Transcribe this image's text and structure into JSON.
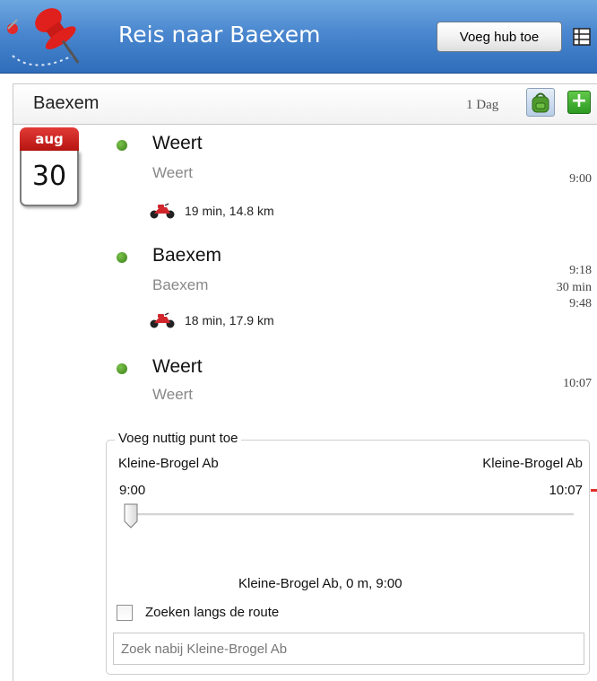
{
  "header": {
    "title": "Reis naar Baexem",
    "add_hub_label": "Voeg hub toe",
    "app_icon": "pushpin-route-icon",
    "grid_icon": "grid-list-icon"
  },
  "subheader": {
    "destination": "Baexem",
    "days": "1 Dag",
    "bag_icon": "backpack-icon",
    "add_icon": "plus-icon",
    "add_symbol": "+"
  },
  "calendar": {
    "month": "aug",
    "day": "30"
  },
  "stops": [
    {
      "name": "Weert",
      "sub": "Weert",
      "time_lines": [
        "9:00"
      ]
    },
    {
      "name": "Baexem",
      "sub": "Baexem",
      "time_lines": [
        "9:18",
        "30 min",
        "9:48"
      ]
    },
    {
      "name": "Weert",
      "sub": "Weert",
      "time_lines": [
        "10:07"
      ]
    }
  ],
  "legs": [
    {
      "icon": "motorcycle-icon",
      "text": "19 min, 14.8 km"
    },
    {
      "icon": "motorcycle-icon",
      "text": "18 min, 17.9 km"
    }
  ],
  "poi_panel": {
    "legend": "Voeg nuttig punt toe",
    "from_place": "Kleine-Brogel Ab",
    "to_place": "Kleine-Brogel Ab",
    "from_time": "9:00",
    "to_time": "10:07",
    "slider_position": 0,
    "summary": "Kleine-Brogel Ab, 0 m, 9:00",
    "search_along_route_label": "Zoeken langs de route",
    "search_along_route_checked": false,
    "search_placeholder": "Zoek nabij Kleine-Brogel Ab"
  },
  "colors": {
    "header_blue": "#4a87cf",
    "calendar_red": "#c9201c",
    "stop_dot_green": "#5aa02c",
    "add_green": "#3aa82a",
    "motorcycle_red": "#d0262c"
  }
}
